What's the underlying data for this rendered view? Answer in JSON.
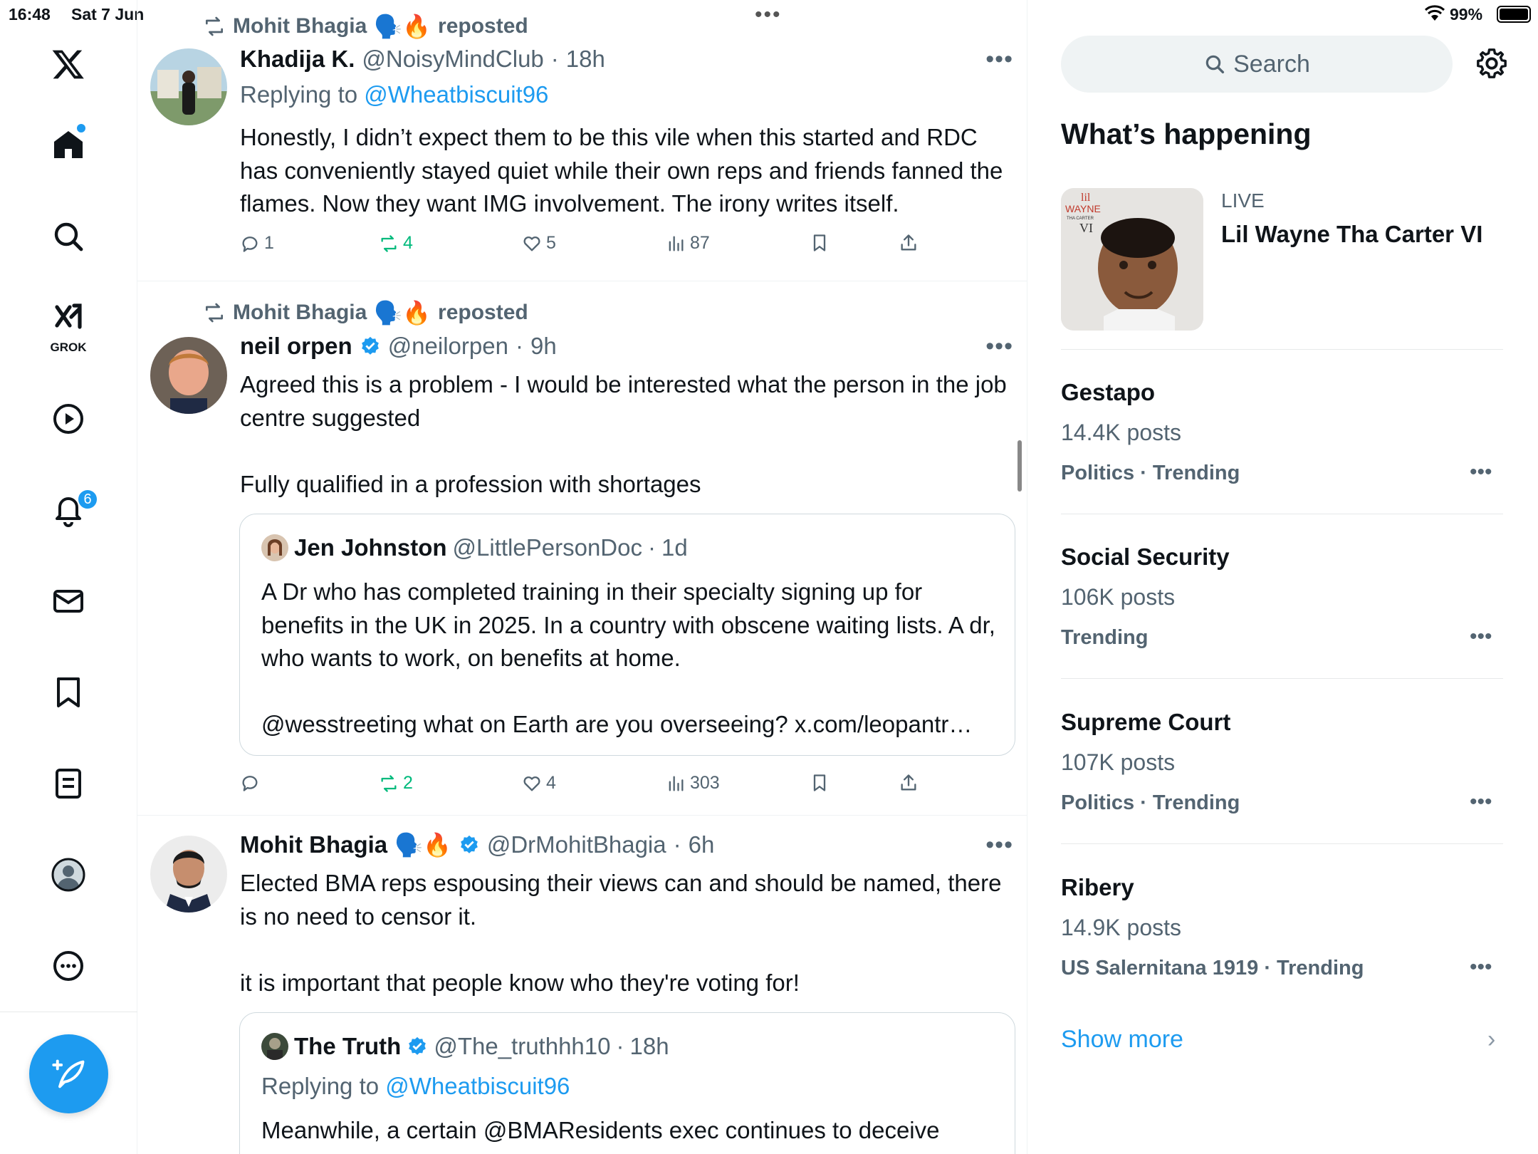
{
  "status_bar": {
    "time": "16:48",
    "date": "Sat 7 Jun",
    "battery": "99%"
  },
  "nav": {
    "grok_label": "GROK",
    "notifications_badge": "6"
  },
  "posts": [
    {
      "repost_by": "Mohit Bhagia",
      "repost_emoji": "🗣️🔥",
      "reposted": "reposted",
      "name": "Khadija K.",
      "handle": "@NoisyMindClub",
      "time": "18h",
      "replying_to_label": "Replying to",
      "replying_to": "@Wheatbiscuit96",
      "body": "Honestly, I didn’t expect them to be this vile when this started and RDC has conveniently stayed quiet while their own reps and friends fanned the flames. Now they want IMG involvement. The irony writes itself.",
      "replies": "1",
      "reposts": "4",
      "likes": "5",
      "views": "87"
    },
    {
      "repost_by": "Mohit Bhagia",
      "repost_emoji": "🗣️🔥",
      "reposted": "reposted",
      "name": "neil orpen",
      "handle": "@neilorpen",
      "time": "9h",
      "body": "Agreed this is a problem - I would be interested what the person in the job centre suggested\n\nFully qualified in a profession with shortages",
      "quote": {
        "name": "Jen Johnston",
        "handle": "@LittlePersonDoc",
        "time": "1d",
        "body": "A Dr who has completed training in their specialty signing up for benefits in the UK in 2025. In a country with obscene waiting lists. A dr, who wants to work, on benefits at home.\n\n@wesstreeting what on Earth are you overseeing? x.com/leopantr…"
      },
      "replies": "",
      "reposts": "2",
      "likes": "4",
      "views": "303"
    },
    {
      "name": "Mohit Bhagia",
      "name_emoji": "🗣️🔥",
      "handle": "@DrMohitBhagia",
      "time": "6h",
      "body": "Elected BMA reps espousing their views can and should be named, there is no need to censor it.\n\nit is important that people know who they're voting for!",
      "quote": {
        "name": "The Truth",
        "handle": "@The_truthhh10",
        "time": "18h",
        "replying_to_label": "Replying to",
        "replying_to": "@Wheatbiscuit96",
        "body": "Meanwhile, a certain @BMAResidents exec continues to deceive"
      }
    }
  ],
  "sidebar": {
    "search_placeholder": "Search",
    "whats_happening": "What’s happening",
    "live": {
      "label": "LIVE",
      "title": "Lil Wayne Tha Carter VI",
      "album_text_1": "lil",
      "album_text_2": "WAYNE",
      "album_text_3": "THA CARTER",
      "album_text_4": "VI"
    },
    "trends": [
      {
        "name": "Gestapo",
        "count": "14.4K posts",
        "category": "Politics · Trending"
      },
      {
        "name": "Social Security",
        "count": "106K posts",
        "category": "Trending"
      },
      {
        "name": "Supreme Court",
        "count": "107K posts",
        "category": "Politics · Trending"
      },
      {
        "name": "Ribery",
        "count": "14.9K posts",
        "category": "US Salernitana 1919 · Trending"
      }
    ],
    "show_more": "Show more"
  },
  "colors": {
    "accent": "#1d9bf0",
    "muted": "#536471",
    "repost_green": "#00ba7c"
  }
}
